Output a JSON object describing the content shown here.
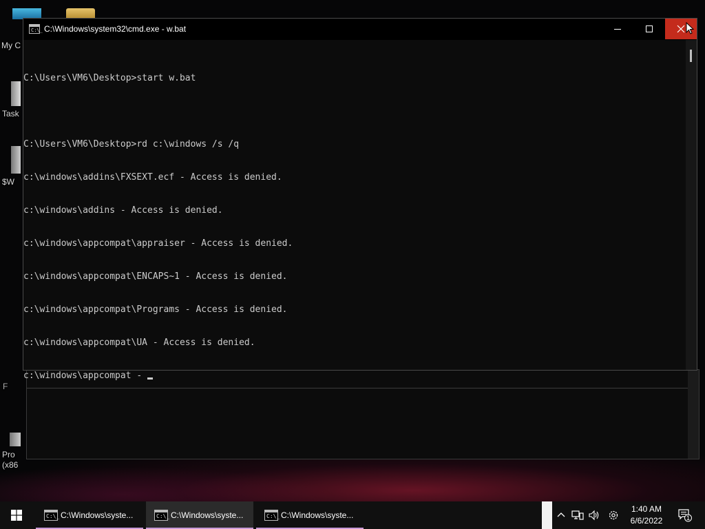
{
  "desktop": {
    "icons": [
      {
        "label": "My C",
        "icon": "computer-icon"
      },
      {
        "label": "",
        "icon": "folder-icon"
      },
      {
        "label": "Task",
        "icon": "shortcut-icon"
      },
      {
        "label": "$W",
        "icon": "shortcut-icon"
      },
      {
        "label": "F",
        "icon": "shortcut-icon"
      },
      {
        "label": "Pro",
        "icon": "shortcut-icon"
      },
      {
        "label": "(x86",
        "icon": ""
      }
    ]
  },
  "cmd_window": {
    "title": "C:\\Windows\\system32\\cmd.exe - w.bat",
    "icon": "console-icon",
    "buttons": {
      "minimize": "minimize-icon",
      "maximize": "maximize-icon",
      "close": "close-icon"
    },
    "lines": [
      "",
      "C:\\Users\\VM6\\Desktop>start w.bat",
      "",
      "C:\\Users\\VM6\\Desktop>rd c:\\windows /s /q",
      "c:\\windows\\addins\\FXSEXT.ecf - Access is denied.",
      "c:\\windows\\addins - Access is denied.",
      "c:\\windows\\appcompat\\appraiser - Access is denied.",
      "c:\\windows\\appcompat\\ENCAPS~1 - Access is denied.",
      "c:\\windows\\appcompat\\Programs - Access is denied.",
      "c:\\windows\\appcompat\\UA - Access is denied."
    ],
    "current_line": "c:\\windows\\appcompat - "
  },
  "taskbar": {
    "start_icon": "windows-logo-icon",
    "items": [
      {
        "label": "C:\\Windows\\syste...",
        "icon": "console-icon",
        "active": false
      },
      {
        "label": "C:\\Windows\\syste...",
        "icon": "console-icon",
        "active": true
      },
      {
        "label": "C:\\Windows\\syste...",
        "icon": "console-icon",
        "active": false
      }
    ],
    "tray": {
      "icons": [
        "chevron-up-icon",
        "network-icon",
        "volume-icon",
        "settings-icon"
      ],
      "time": "1:40 AM",
      "date": "6/6/2022",
      "notification_count": "1"
    }
  }
}
